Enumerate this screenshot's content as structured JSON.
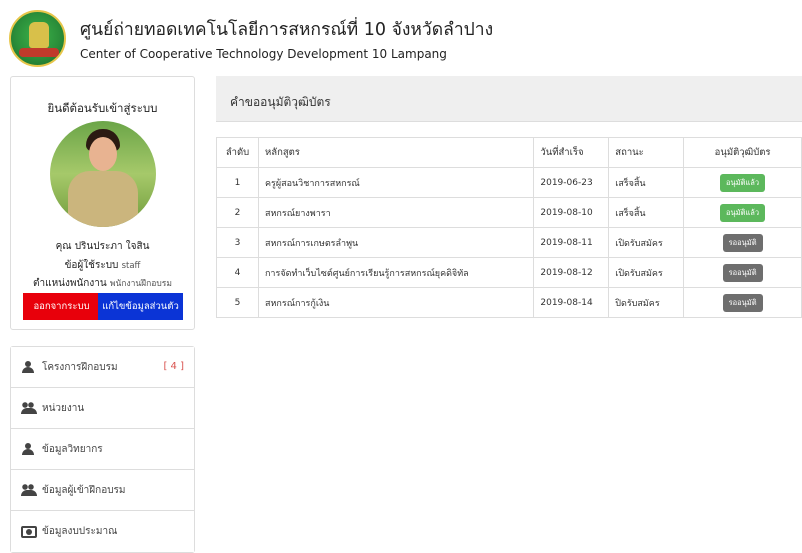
{
  "header": {
    "title_th": "ศูนย์ถ่ายทอดเทคโนโลยีการสหกรณ์ที่ 10 จังหวัดลำปาง",
    "title_en": "Center of Cooperative Technology Development 10 Lampang"
  },
  "profile": {
    "welcome": "ยินดีต้อนรับเข้าสู่ระบบ",
    "name": "คุณ  ปรินประภา  ใจสิน",
    "role_label": "ข้อผู้ใช้ระบบ",
    "role_value": "staff",
    "position_label": "ตำแหน่งพนักงาน",
    "position_value": "พนักงานฝึกอบรม",
    "logout_label": "ออกจากระบบ",
    "edit_label": "แก้ไขข้อมูลส่วนตัว"
  },
  "menu": {
    "items": [
      {
        "label": "โครงการฝึกอบรม",
        "icon": "user-icon",
        "count": "[ 4 ]"
      },
      {
        "label": "หน่วยงาน",
        "icon": "users-icon"
      },
      {
        "label": "ข้อมูลวิทยากร",
        "icon": "user-icon"
      },
      {
        "label": "ข้อมูลผู้เข้าฝึกอบรม",
        "icon": "users-icon"
      },
      {
        "label": "ข้อมูลงบประมาณ",
        "icon": "money-icon"
      }
    ]
  },
  "panel": {
    "title": "คำขออนุมัติวุฒิบัตร"
  },
  "table": {
    "headers": [
      "ลำดับ",
      "หลักสูตร",
      "วันที่สำเร็จ",
      "สถานะ",
      "อนุมัติวุฒิบัตร"
    ],
    "rows": [
      {
        "no": "1",
        "course": "ครูผู้สอนวิชาการสหกรณ์",
        "date": "2019-06-23",
        "status": "เสร็จสิ้น",
        "action": "อนุมัติแล้ว",
        "approved": true
      },
      {
        "no": "2",
        "course": "สหกรณ์ยางพารา",
        "date": "2019-08-10",
        "status": "เสร็จสิ้น",
        "action": "อนุมัติแล้ว",
        "approved": true
      },
      {
        "no": "3",
        "course": "สหกรณ์การเกษตรลำพูน",
        "date": "2019-08-11",
        "status": "เปิดรับสมัคร",
        "action": "รออนุมัติ",
        "approved": false
      },
      {
        "no": "4",
        "course": "การจัดทำเว็บไซต์ศูนย์การเรียนรู้การสหกรณ์ยุคดิจิทัล",
        "date": "2019-08-12",
        "status": "เปิดรับสมัคร",
        "action": "รออนุมัติ",
        "approved": false
      },
      {
        "no": "5",
        "course": "สหกรณ์การกู้เงิน",
        "date": "2019-08-14",
        "status": "ปิดรับสมัคร",
        "action": "รออนุมัติ",
        "approved": false
      }
    ]
  },
  "colors": {
    "logout": "#e8000b",
    "edit": "#0b34d6",
    "approved": "#5cb85c",
    "pending": "#6e6e6e",
    "count": "#d9534f"
  }
}
